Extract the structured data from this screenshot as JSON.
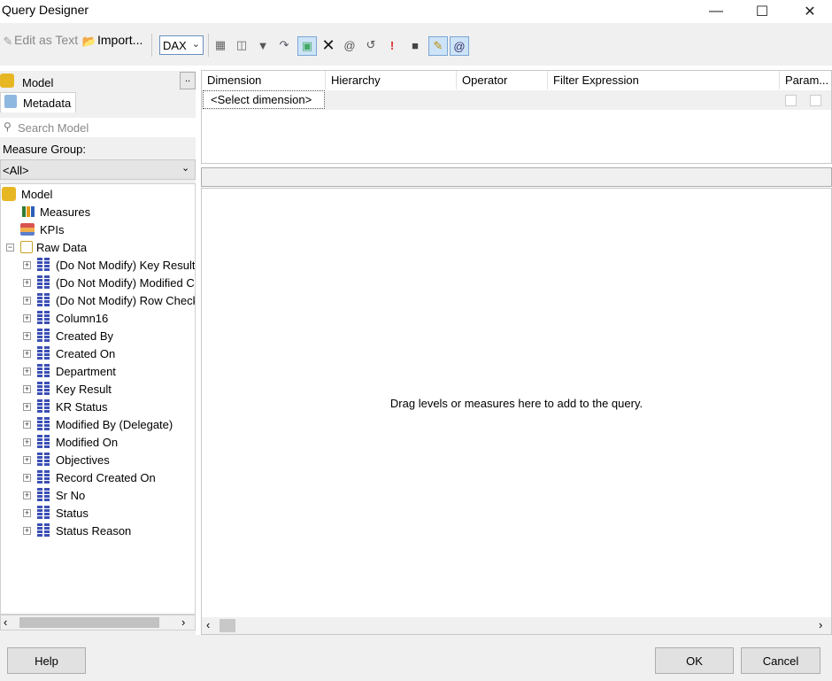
{
  "window": {
    "title": "Query Designer",
    "controls": [
      "minimize",
      "maximize",
      "close"
    ]
  },
  "toolbar": {
    "edit_as_text": "Edit as Text",
    "import": "Import...",
    "language": "DAX"
  },
  "left_panel": {
    "header": "Model",
    "ellipsis": "..",
    "tab": "Metadata",
    "search_placeholder": "Search Model",
    "measure_group_label": "Measure Group:",
    "measure_group_value": "<All>",
    "tree": {
      "root": "Model",
      "measures": "Measures",
      "kpis": "KPIs",
      "table": "Raw Data",
      "columns": [
        "(Do Not Modify) Key Result:",
        "(Do Not Modify) Modified C",
        "(Do Not Modify) Row Check",
        "Column16",
        "Created By",
        "Created On",
        "Department",
        "Key Result",
        "KR Status",
        "Modified By (Delegate)",
        "Modified On",
        "Objectives",
        "Record Created On",
        "Sr No",
        "Status",
        "Status Reason"
      ]
    }
  },
  "filter_grid": {
    "columns": [
      "Dimension",
      "Hierarchy",
      "Operator",
      "Filter Expression",
      "Param..."
    ],
    "placeholder_row": "<Select dimension>"
  },
  "results": {
    "hint": "Drag levels or measures here to add to the query."
  },
  "footer": {
    "help": "Help",
    "ok": "OK",
    "cancel": "Cancel"
  }
}
